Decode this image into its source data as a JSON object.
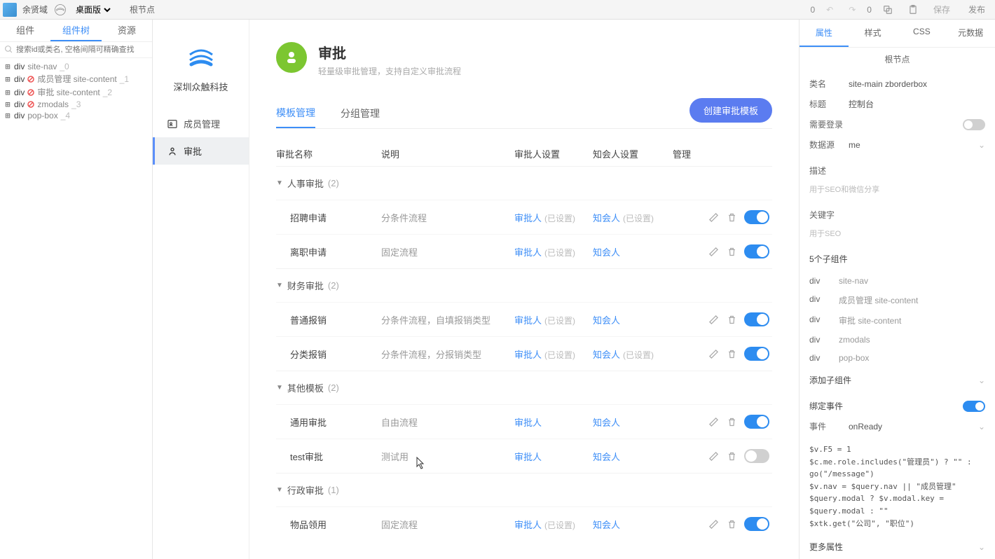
{
  "toolbar": {
    "username": "余贤域",
    "viewMode": "桌面版",
    "breadcrumb": "根节点",
    "undoCount": "0",
    "redoCount": "0",
    "saveLabel": "保存",
    "publishLabel": "发布"
  },
  "leftTabs": [
    "组件",
    "组件树",
    "资源"
  ],
  "leftActiveTab": 1,
  "searchPlaceholder": "搜索id或类名, 空格间隔可精确查找",
  "tree": [
    {
      "tag": "div",
      "sub": "site-nav",
      "idx": "_0"
    },
    {
      "tag": "div",
      "sub": "成员管理 site-content",
      "idx": "_1",
      "red": true
    },
    {
      "tag": "div",
      "sub": "审批 site-content",
      "idx": "_2",
      "red": true
    },
    {
      "tag": "div",
      "sub": "zmodals",
      "idx": "_3",
      "red": true
    },
    {
      "tag": "div",
      "sub": "pop-box",
      "idx": "_4"
    }
  ],
  "innerApp": {
    "company": "深圳众触科技",
    "sideItems": [
      {
        "icon": "contacts-icon",
        "label": "成员管理"
      },
      {
        "icon": "approval-icon",
        "label": "审批"
      }
    ],
    "sideActive": 1,
    "pageTitle": "审批",
    "pageDesc": "轻量级审批管理，支持自定义审批流程",
    "subTabs": [
      "模板管理",
      "分组管理"
    ],
    "subActive": 0,
    "createBtn": "创建审批模板",
    "columns": {
      "name": "审批名称",
      "desc": "说明",
      "approver": "审批人设置",
      "notify": "知会人设置",
      "manage": "管理"
    },
    "linkApprover": "审批人",
    "linkNotify": "知会人",
    "setHint": "(已设置)",
    "groups": [
      {
        "title": "人事审批",
        "count": "(2)",
        "rows": [
          {
            "name": "招聘申请",
            "desc": "分条件流程",
            "approverSet": true,
            "notifySet": true,
            "on": true
          },
          {
            "name": "离职申请",
            "desc": "固定流程",
            "approverSet": true,
            "notifySet": false,
            "on": true
          }
        ]
      },
      {
        "title": "财务审批",
        "count": "(2)",
        "rows": [
          {
            "name": "普通报销",
            "desc": "分条件流程，自填报销类型",
            "approverSet": true,
            "notifySet": false,
            "on": true
          },
          {
            "name": "分类报销",
            "desc": "分条件流程，分报销类型",
            "approverSet": true,
            "notifySet": true,
            "on": true
          }
        ]
      },
      {
        "title": "其他模板",
        "count": "(2)",
        "rows": [
          {
            "name": "通用审批",
            "desc": "自由流程",
            "approverSet": false,
            "notifySet": false,
            "on": true
          },
          {
            "name": "test审批",
            "desc": "测试用",
            "approverSet": false,
            "notifySet": false,
            "on": false
          }
        ]
      },
      {
        "title": "行政审批",
        "count": "(1)",
        "rows": [
          {
            "name": "物品领用",
            "desc": "固定流程",
            "approverSet": true,
            "notifySet": false,
            "on": true
          }
        ]
      }
    ]
  },
  "props": {
    "tabs": [
      "属性",
      "样式",
      "CSS",
      "元数据"
    ],
    "tabActive": 0,
    "title": "根节点",
    "classLabel": "类名",
    "classValue": "site-main zborderbox",
    "titleLabel": "标题",
    "titleValue": "控制台",
    "needLoginLabel": "需要登录",
    "needLoginOn": false,
    "dataSourceLabel": "数据源",
    "dataSourceValue": "me",
    "descLabel": "描述",
    "descHint": "用于SEO和微信分享",
    "keywordLabel": "关键字",
    "keywordHint": "用于SEO",
    "childCountLabel": "5个子组件",
    "children": [
      {
        "t": "div",
        "n": "site-nav"
      },
      {
        "t": "div",
        "n": "成员管理 site-content"
      },
      {
        "t": "div",
        "n": "审批 site-content"
      },
      {
        "t": "div",
        "n": "zmodals"
      },
      {
        "t": "div",
        "n": "pop-box"
      }
    ],
    "addChildLabel": "添加子组件",
    "bindEventLabel": "绑定事件",
    "bindEventOn": true,
    "eventLabel": "事件",
    "eventValue": "onReady",
    "code": "$v.F5 = 1\n$c.me.role.includes(\"管理员\") ? \"\" : go(\"/message\")\n$v.nav = $query.nav || \"成员管理\"\n$query.modal ? $v.modal.key = $query.modal : \"\"\n$xtk.get(\"公司\", \"职位\")",
    "morePropsLabel": "更多属性"
  }
}
